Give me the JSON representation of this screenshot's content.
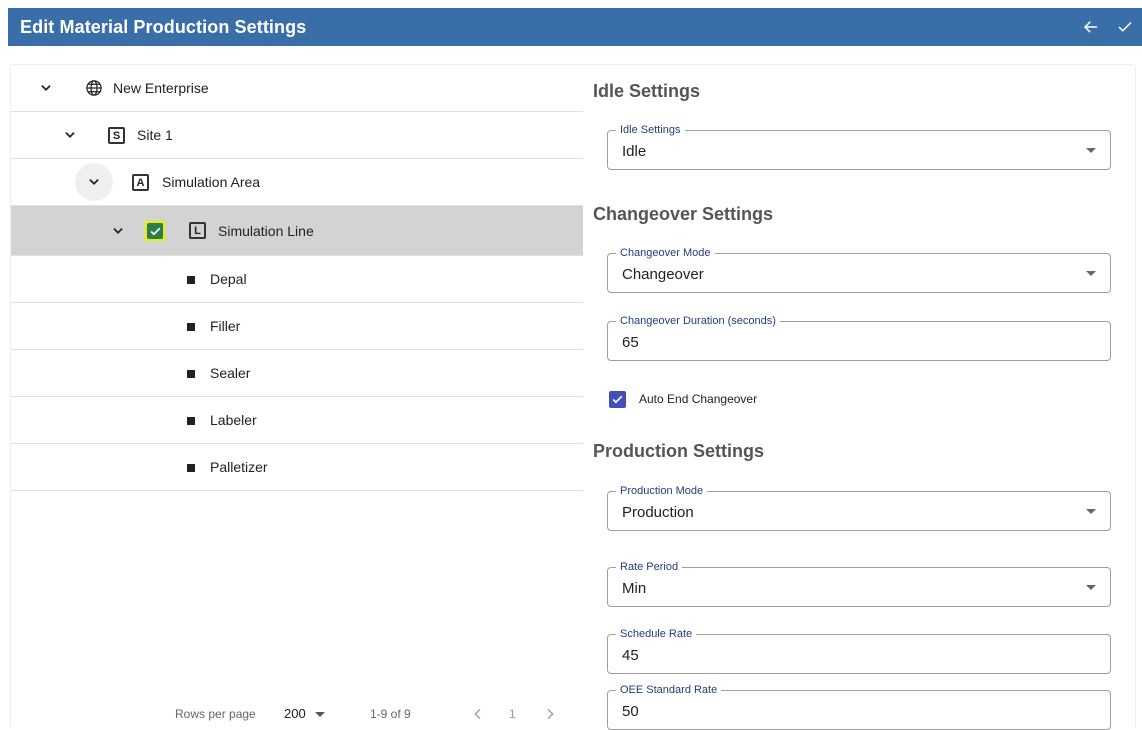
{
  "header": {
    "title": "Edit Material Production Settings",
    "back_icon": "arrow-left-icon",
    "save_icon": "check-icon",
    "color": "#3a6ea8"
  },
  "tree": {
    "enterprise": {
      "label": "New Enterprise",
      "icon": "globe-icon"
    },
    "site": {
      "label": "Site 1",
      "badge": "S"
    },
    "area": {
      "label": "Simulation Area",
      "badge": "A"
    },
    "line": {
      "label": "Simulation Line",
      "badge": "L",
      "selected": true
    },
    "machines": [
      "Depal",
      "Filler",
      "Sealer",
      "Labeler",
      "Palletizer"
    ]
  },
  "pager": {
    "rows_label": "Rows per page",
    "rows_value": "200",
    "range": "1-9 of 9",
    "page": "1"
  },
  "idle": {
    "section_title": "Idle Settings",
    "field_label": "Idle Settings",
    "field_value": "Idle"
  },
  "changeover": {
    "section_title": "Changeover Settings",
    "mode_label": "Changeover Mode",
    "mode_value": "Changeover",
    "duration_label": "Changeover Duration (seconds)",
    "duration_value": "65",
    "auto_end_label": "Auto End Changeover",
    "auto_end_checked": true
  },
  "production": {
    "section_title": "Production Settings",
    "mode_label": "Production Mode",
    "mode_value": "Production",
    "rate_period_label": "Rate Period",
    "rate_period_value": "Min",
    "schedule_rate_label": "Schedule Rate",
    "schedule_rate_value": "45",
    "oee_rate_label": "OEE Standard Rate",
    "oee_rate_value": "50"
  },
  "colors": {
    "selected_row": "#d3d3d3",
    "highlight": "#e8f000",
    "checkbox": "#3f51b5"
  }
}
